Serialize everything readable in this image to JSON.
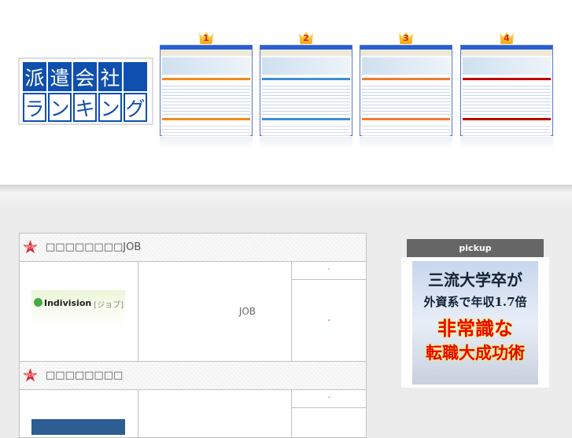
{
  "logo": {
    "row1": [
      "派",
      "遣",
      "会",
      "社",
      ""
    ],
    "row2": [
      "ラ",
      "ン",
      "キ",
      "ン",
      "グ"
    ]
  },
  "ranking": [
    {
      "rank": "1",
      "accent": "#f08a20"
    },
    {
      "rank": "2",
      "accent": "#3c8fd8"
    },
    {
      "rank": "3",
      "accent": "#f07a30"
    },
    {
      "rank": "4",
      "accent": "#c00000"
    }
  ],
  "sections": [
    {
      "title": "□□□□□□□□JOB",
      "badge": "NEW",
      "logo_name": "Indivision",
      "logo_sub": "[ジョブ]",
      "description": "JOB",
      "link1": "-",
      "link2": "-"
    },
    {
      "title": "□□□□□□□□",
      "badge": "NEW",
      "link1": "-"
    }
  ],
  "pickup": {
    "label": "pickup",
    "ad": {
      "line1": "三流大学卒が",
      "line2": "外資系で年収1.7倍",
      "line3": "非常識な",
      "line4": "転職大成功術"
    }
  }
}
